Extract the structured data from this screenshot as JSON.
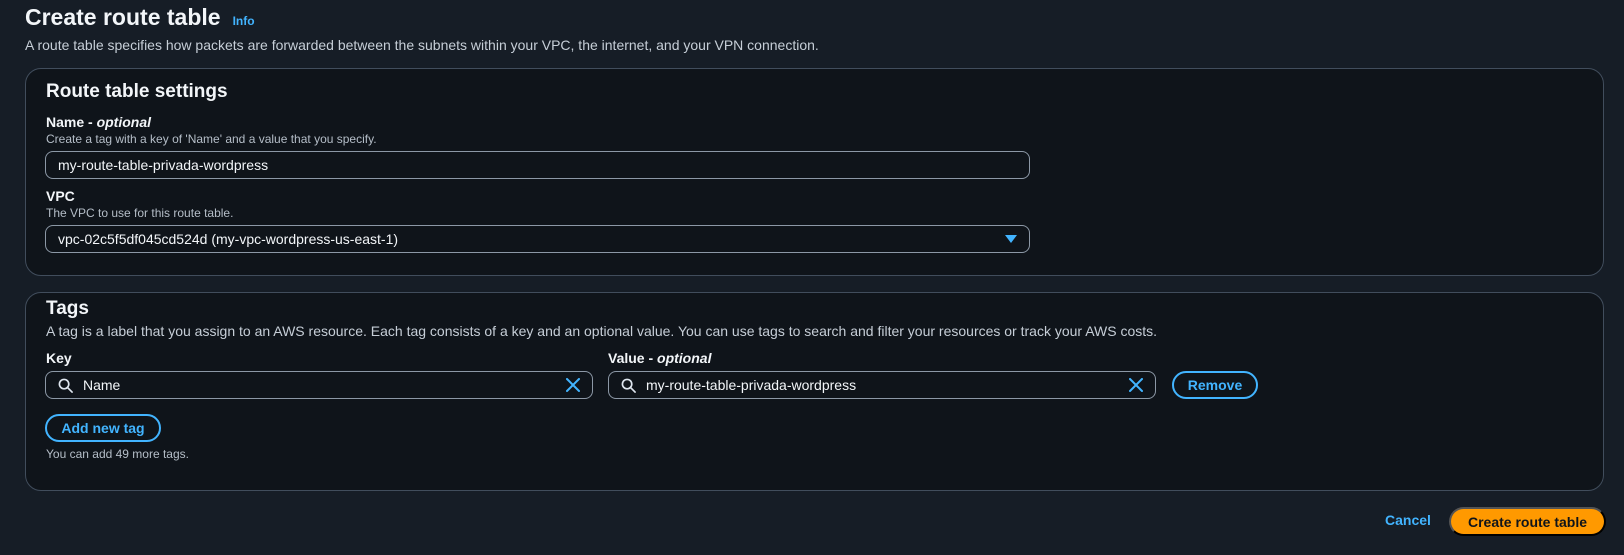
{
  "header": {
    "title": "Create route table",
    "info_label": "Info",
    "description": "A route table specifies how packets are forwarded between the subnets within your VPC, the internet, and your VPN connection."
  },
  "settings": {
    "title": "Route table settings",
    "name": {
      "label": "Name - ",
      "optional": "optional",
      "hint": "Create a tag with a key of 'Name' and a value that you specify.",
      "value": "my-route-table-privada-wordpress"
    },
    "vpc": {
      "label": "VPC",
      "hint": "The VPC to use for this route table.",
      "selected": "vpc-02c5f5df045cd524d (my-vpc-wordpress-us-east-1)"
    }
  },
  "tags": {
    "title": "Tags",
    "description": "A tag is a label that you assign to an AWS resource. Each tag consists of a key and an optional value. You can use tags to search and filter your resources or track your AWS costs.",
    "key_label": "Key",
    "value_label": "Value - ",
    "value_optional": "optional",
    "rows": [
      {
        "key": "Name",
        "value": "my-route-table-privada-wordpress"
      }
    ],
    "remove_label": "Remove",
    "add_label": "Add new tag",
    "remaining_note": "You can add 49 more tags."
  },
  "footer": {
    "cancel_label": "Cancel",
    "create_label": "Create route table"
  },
  "colors": {
    "accent": "#42b4ff",
    "primary": "#ff9900",
    "background": "#161d26"
  },
  "icons": [
    "search-icon",
    "clear-icon",
    "caret-down-icon"
  ]
}
